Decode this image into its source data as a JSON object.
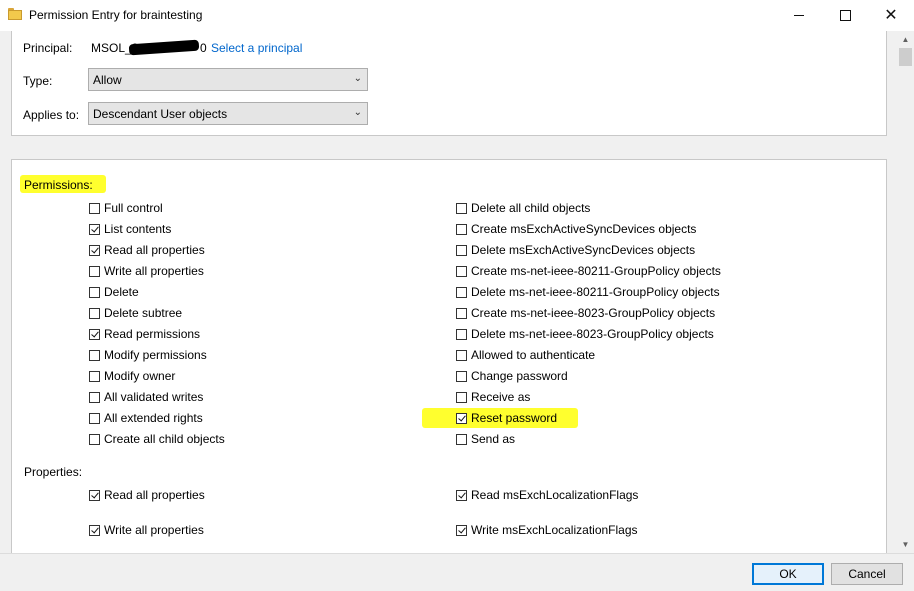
{
  "window": {
    "title": "Permission Entry for braintesting"
  },
  "principal": {
    "label": "Principal:",
    "value_start": "MSOL_8",
    "value_end": "0",
    "select_link": "Select a principal"
  },
  "type": {
    "label": "Type:",
    "value": "Allow"
  },
  "applies_to": {
    "label": "Applies to:",
    "value": "Descendant User objects"
  },
  "permissions": {
    "heading": "Permissions:",
    "left": [
      {
        "label": "Full control",
        "checked": false
      },
      {
        "label": "List contents",
        "checked": true
      },
      {
        "label": "Read all properties",
        "checked": true
      },
      {
        "label": "Write all properties",
        "checked": false
      },
      {
        "label": "Delete",
        "checked": false
      },
      {
        "label": "Delete subtree",
        "checked": false
      },
      {
        "label": "Read permissions",
        "checked": true
      },
      {
        "label": "Modify permissions",
        "checked": false
      },
      {
        "label": "Modify owner",
        "checked": false
      },
      {
        "label": "All validated writes",
        "checked": false
      },
      {
        "label": "All extended rights",
        "checked": false
      },
      {
        "label": "Create all child objects",
        "checked": false
      }
    ],
    "right": [
      {
        "label": "Delete all child objects",
        "checked": false
      },
      {
        "label": "Create msExchActiveSyncDevices objects",
        "checked": false
      },
      {
        "label": "Delete msExchActiveSyncDevices objects",
        "checked": false
      },
      {
        "label": "Create ms-net-ieee-80211-GroupPolicy objects",
        "checked": false
      },
      {
        "label": "Delete ms-net-ieee-80211-GroupPolicy objects",
        "checked": false
      },
      {
        "label": "Create ms-net-ieee-8023-GroupPolicy objects",
        "checked": false
      },
      {
        "label": "Delete ms-net-ieee-8023-GroupPolicy objects",
        "checked": false
      },
      {
        "label": "Allowed to authenticate",
        "checked": false
      },
      {
        "label": "Change password",
        "checked": false
      },
      {
        "label": "Receive as",
        "checked": false
      },
      {
        "label": "Reset password",
        "checked": true
      },
      {
        "label": "Send as",
        "checked": false
      }
    ]
  },
  "properties": {
    "heading": "Properties:",
    "left": [
      {
        "label": "Read all properties",
        "checked": true
      },
      {
        "label": "Write all properties",
        "checked": true
      }
    ],
    "right": [
      {
        "label": "Read msExchLocalizationFlags",
        "checked": true
      },
      {
        "label": "Write msExchLocalizationFlags",
        "checked": true
      }
    ]
  },
  "buttons": {
    "ok": "OK",
    "cancel": "Cancel"
  },
  "colors": {
    "highlight": "#ffff2e",
    "link": "#0066cc",
    "accent": "#0078d7"
  }
}
